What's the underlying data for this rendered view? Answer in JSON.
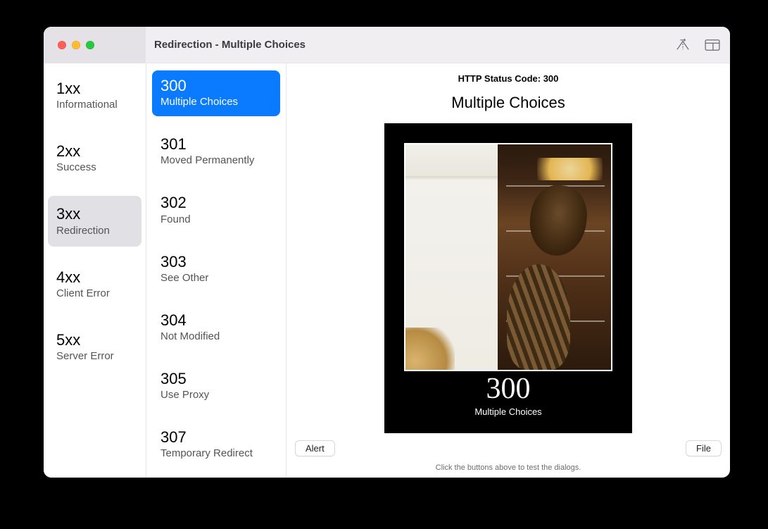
{
  "window_title": "Redirection - Multiple Choices",
  "categories": [
    {
      "code": "1xx",
      "label": "Informational",
      "selected": false
    },
    {
      "code": "2xx",
      "label": "Success",
      "selected": false
    },
    {
      "code": "3xx",
      "label": "Redirection",
      "selected": true
    },
    {
      "code": "4xx",
      "label": "Client Error",
      "selected": false
    },
    {
      "code": "5xx",
      "label": "Server Error",
      "selected": false
    }
  ],
  "subcodes": [
    {
      "code": "300",
      "label": "Multiple Choices",
      "selected": true
    },
    {
      "code": "301",
      "label": "Moved Permanently",
      "selected": false
    },
    {
      "code": "302",
      "label": "Found",
      "selected": false
    },
    {
      "code": "303",
      "label": "See Other",
      "selected": false
    },
    {
      "code": "304",
      "label": "Not Modified",
      "selected": false
    },
    {
      "code": "305",
      "label": "Use Proxy",
      "selected": false
    },
    {
      "code": "307",
      "label": "Temporary Redirect",
      "selected": false
    }
  ],
  "detail": {
    "heading_code": "HTTP Status Code: 300",
    "heading_name": "Multiple Choices",
    "poster_number": "300",
    "poster_caption": "Multiple Choices"
  },
  "buttons": {
    "alert": "Alert",
    "file": "File"
  },
  "hint": "Click the buttons above to test the dialogs."
}
